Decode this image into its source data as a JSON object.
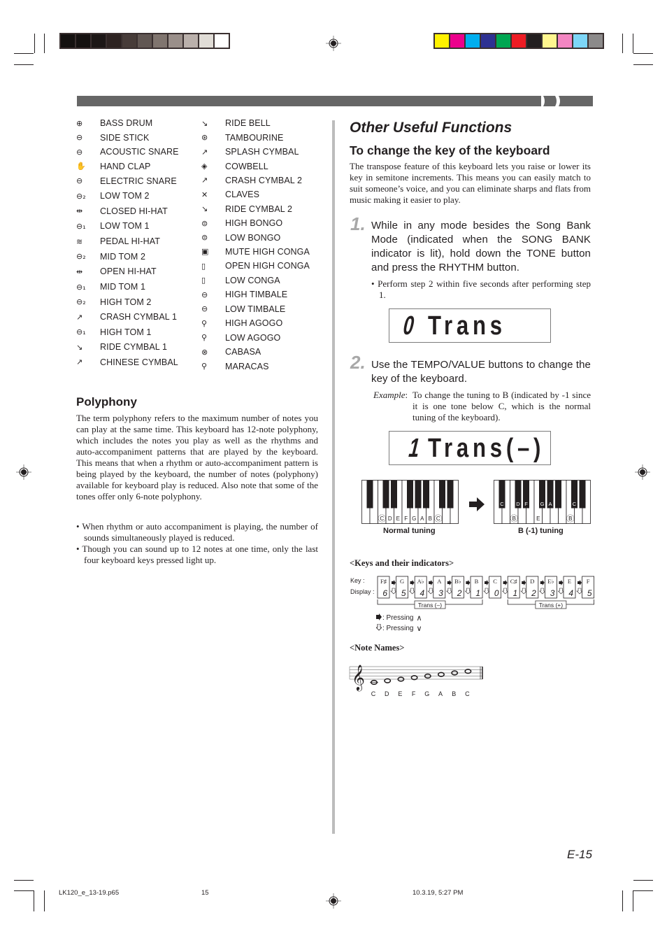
{
  "print_marks": {
    "gray_swatches": [
      "#141110",
      "#141110",
      "#1c1716",
      "#2d2321",
      "#473c39",
      "#615753",
      "#80756f",
      "#9a8f8a",
      "#bab0ab",
      "#e0dcd6",
      "#ffffff"
    ],
    "color_swatches": [
      "#fff200",
      "#ec008c",
      "#00aeef",
      "#2e3192",
      "#00a651",
      "#ed1c24",
      "#231f20",
      "#fff68f",
      "#f386c2",
      "#7dd6f7",
      "#8c8a8a"
    ]
  },
  "drum_list": {
    "left": [
      {
        "icon": "bass-drum-icon",
        "glyph": "⊕",
        "label": "BASS DRUM"
      },
      {
        "icon": "side-stick-icon",
        "glyph": "⊖",
        "label": "SIDE STICK"
      },
      {
        "icon": "acoustic-snare-icon",
        "glyph": "⊖",
        "label": "ACOUSTIC SNARE"
      },
      {
        "icon": "hand-clap-icon",
        "glyph": "✋",
        "label": "HAND CLAP"
      },
      {
        "icon": "electric-snare-icon",
        "glyph": "⊖",
        "label": "ELECTRIC SNARE"
      },
      {
        "icon": "low-tom-2-icon",
        "glyph": "⊖₂",
        "label": "LOW TOM 2"
      },
      {
        "icon": "closed-hi-hat-icon",
        "glyph": "⇹",
        "label": "CLOSED HI-HAT"
      },
      {
        "icon": "low-tom-1-icon",
        "glyph": "⊖₁",
        "label": "LOW TOM 1"
      },
      {
        "icon": "pedal-hi-hat-icon",
        "glyph": "≋",
        "label": "PEDAL HI-HAT"
      },
      {
        "icon": "mid-tom-2-icon",
        "glyph": "⊖₂",
        "label": "MID TOM 2"
      },
      {
        "icon": "open-hi-hat-icon",
        "glyph": "⇹",
        "label": "OPEN HI-HAT"
      },
      {
        "icon": "mid-tom-1-icon",
        "glyph": "⊖₁",
        "label": "MID TOM 1"
      },
      {
        "icon": "high-tom-2-icon",
        "glyph": "⊖₂",
        "label": "HIGH TOM 2"
      },
      {
        "icon": "crash-cymbal-1-icon",
        "glyph": "↗",
        "label": "CRASH CYMBAL 1"
      },
      {
        "icon": "high-tom-1-icon",
        "glyph": "⊖₁",
        "label": "HIGH TOM 1"
      },
      {
        "icon": "ride-cymbal-1-icon",
        "glyph": "↘",
        "label": "RIDE CYMBAL 1"
      },
      {
        "icon": "chinese-cymbal-icon",
        "glyph": "↗",
        "label": "CHINESE CYMBAL"
      }
    ],
    "right": [
      {
        "icon": "ride-bell-icon",
        "glyph": "↘",
        "label": "RIDE BELL"
      },
      {
        "icon": "tambourine-icon",
        "glyph": "⊛",
        "label": "TAMBOURINE"
      },
      {
        "icon": "splash-cymbal-icon",
        "glyph": "↗",
        "label": "SPLASH CYMBAL"
      },
      {
        "icon": "cowbell-icon",
        "glyph": "◈",
        "label": "COWBELL"
      },
      {
        "icon": "crash-cymbal-2-icon",
        "glyph": "↗",
        "label": "CRASH CYMBAL 2"
      },
      {
        "icon": "claves-icon",
        "glyph": "✕",
        "label": "CLAVES"
      },
      {
        "icon": "ride-cymbal-2-icon",
        "glyph": "↘",
        "label": "RIDE CYMBAL 2"
      },
      {
        "icon": "high-bongo-icon",
        "glyph": "⊜",
        "label": "HIGH BONGO"
      },
      {
        "icon": "low-bongo-icon",
        "glyph": "⊜",
        "label": "LOW BONGO"
      },
      {
        "icon": "mute-high-conga-icon",
        "glyph": "▣",
        "label": "MUTE HIGH CONGA"
      },
      {
        "icon": "open-high-conga-icon",
        "glyph": "▯",
        "label": "OPEN HIGH CONGA"
      },
      {
        "icon": "low-conga-icon",
        "glyph": "▯",
        "label": "LOW CONGA"
      },
      {
        "icon": "high-timbale-icon",
        "glyph": "⊖",
        "label": "HIGH TIMBALE"
      },
      {
        "icon": "low-timbale-icon",
        "glyph": "⊖",
        "label": "LOW TIMBALE"
      },
      {
        "icon": "high-agogo-icon",
        "glyph": "⚲",
        "label": "HIGH AGOGO"
      },
      {
        "icon": "low-agogo-icon",
        "glyph": "⚲",
        "label": "LOW AGOGO"
      },
      {
        "icon": "cabasa-icon",
        "glyph": "⊗",
        "label": "CABASA"
      },
      {
        "icon": "maracas-icon",
        "glyph": "⚲",
        "label": "MARACAS"
      }
    ]
  },
  "polyphony": {
    "title": "Polyphony",
    "body": "The term polyphony refers to the maximum number of notes you can play at the same time. This keyboard has 12-note polyphony, which includes the notes you play as well as the rhythms and auto-accompaniment patterns that are played by the keyboard. This means that when a rhythm or auto-accompaniment pattern is being played by the keyboard, the number of notes (polyphony) available for keyboard play is reduced. Also note that some of the tones offer only 6-note polyphony.",
    "bullets": [
      "• When rhythm or auto accompaniment is playing, the number of sounds simultaneously played is reduced.",
      "• Though you can sound up to 12 notes at one time, only the last four keyboard keys pressed light up."
    ]
  },
  "other_functions": {
    "title": "Other Useful Functions",
    "subtitle": "To change the key of the keyboard",
    "intro": "The transpose feature of this keyboard lets you raise or lower its key in semitone increments. This means you can easily match to suit someone’s voice, and you can eliminate sharps and flats from music making it easier to play.",
    "step1": {
      "num": "1.",
      "text": "While in any mode besides the Song Bank Mode (indicated when the SONG BANK indicator is lit), hold down the TONE button and press the RHYTHM button.",
      "bullet": "• Perform step 2 within five seconds after performing step 1."
    },
    "lcd1": {
      "digit": "0",
      "text": "Trans"
    },
    "step2": {
      "num": "2.",
      "text": "Use the TEMPO/VALUE buttons to change the key of the keyboard.",
      "example_label": "Example",
      "example_colon": ":",
      "example_text": "To change the tuning to B (indicated by -1 since it is one tone below C, which is the normal tuning of the keyboard)."
    },
    "lcd2": {
      "digit": "1",
      "text": "Trans(–)"
    }
  },
  "keyboard_diagram": {
    "normal": {
      "caption": "Normal tuning",
      "white_labels": [
        "",
        "",
        "C",
        "D",
        "E",
        "F",
        "G",
        "A",
        "B",
        "C",
        "",
        ""
      ],
      "circled": [
        2,
        9
      ]
    },
    "shifted": {
      "caption": "B (-1) tuning",
      "white_labels": [
        "",
        "",
        "B",
        "",
        "",
        "E",
        "",
        "",
        "",
        "B",
        "",
        ""
      ],
      "black_labels": [
        "",
        "C",
        "D",
        "F",
        "G",
        "A",
        "",
        "C",
        ""
      ],
      "circled": [
        2,
        9
      ]
    }
  },
  "keys_indicators": {
    "heading": "<Keys and their indicators>",
    "key_label": "Key :",
    "display_label": "Display :",
    "keys": [
      {
        "key": "F♯",
        "display": "6"
      },
      {
        "key": "G",
        "display": "5"
      },
      {
        "key": "A♭",
        "display": "4"
      },
      {
        "key": "A",
        "display": "3"
      },
      {
        "key": "B♭",
        "display": "2"
      },
      {
        "key": "B",
        "display": "1"
      },
      {
        "key": "C",
        "display": "0"
      },
      {
        "key": "C♯",
        "display": "1"
      },
      {
        "key": "D",
        "display": "2"
      },
      {
        "key": "E♭",
        "display": "3"
      },
      {
        "key": "E",
        "display": "4"
      },
      {
        "key": "F",
        "display": "5"
      }
    ],
    "trans_minus": "Trans (–)",
    "trans_plus": "Trans (+)",
    "legend_up": ": Pressing",
    "legend_down": ": Pressing"
  },
  "note_names": {
    "heading": "<Note Names>",
    "notes": [
      "C",
      "D",
      "E",
      "F",
      "G",
      "A",
      "B",
      "C"
    ]
  },
  "footer": {
    "page_label": "E-15",
    "file": "LK120_e_13-19.p65",
    "page": "15",
    "timestamp": "10.3.19, 5:27 PM"
  }
}
